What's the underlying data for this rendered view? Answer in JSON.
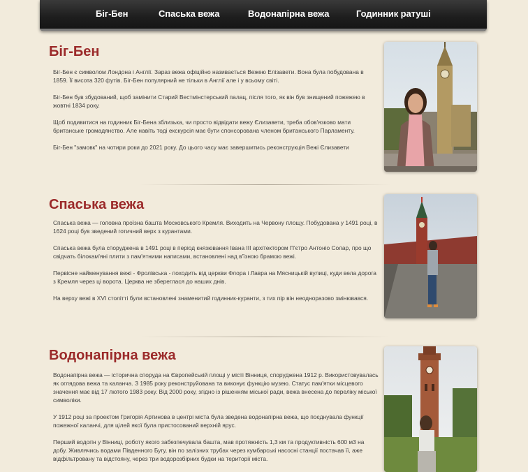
{
  "nav": {
    "items": [
      {
        "label": "Біг-Бен"
      },
      {
        "label": "Спаська вежа"
      },
      {
        "label": "Водонапірна вежа"
      },
      {
        "label": "Годинник ратуші"
      }
    ]
  },
  "sections": [
    {
      "title": "Біг-Бен",
      "paragraphs": [
        "Біг-Бен є символом Лондона і Англії. Зараз вежа офіційно називається Вежею Елізавети. Вона була побудована в 1859. Її висота 320 футів. Біг-Бен популярний не тільки в Англії але і у всьому світі.",
        "Біг-Бен був збудований, щоб замінити Старий Вестмінстерський палац, після того, як він був знищений пожежею в жовтні 1834 року.",
        "Щоб подивитися на годинник Біг-Бена зблизька, чи просто відвідати вежу Єлизавети, треба обов'язково мати британське громадянство. Але навіть тоді екскурсія має бути спонсорована членом британського Парламенту.",
        "Біг-Бен \"замовк\" на чотири роки до 2021 року. До цього часу має завершитись реконструкція Вежі Єлизавети"
      ]
    },
    {
      "title": "Спаська вежа",
      "paragraphs": [
        "Спаська вежа — головна проїзна башта Московського Кремля. Виходить на Червону площу. Побудована у 1491 році, в 1624 році був зведений готичний верх з курантами.",
        "Спаська вежа була споруджена в 1491 році в період князювання Івана III архітектором П'єтро Антоніо Солар, про що свідчать білокам'яні плити з пам'ятними написами, встановлені над в'їзною брамою вежі.",
        "Первісне найменування вежі - Фролівська - походить від церкви Флора і Лавра на Мясницькій вулиці, куди вела дорога з Кремля через ці ворота. Церква не збереглася до наших днів.",
        "На верху вежі в XVI столітті були встановлені знаменитий годинник-куранти, з тих пір він неодноразово змінювався."
      ]
    },
    {
      "title": "Водонапірна вежа",
      "paragraphs": [
        "Водонапірна вежа — історична споруда на Європейській площі у місті Вінниця, споруджена 1912 р. Використовувалась як оглядова вежа та каланча. З 1985 року реконструйована та виконує функцію музею. Статус пам'ятки місцевого значення має від 17 лютого 1983 року. Від 2000 року, згідно із рішенням міської ради, вежа внесена до переліку міської символіки.",
        "У 1912 році за проектом Григорія Артинова в центрі міста була зведена водонапірна вежа, що поєднувала функції пожежної каланчі, для цілей якої була пристосований верхній ярус.",
        "Перший водогін у Вінниці, роботу якого забезпечувала башта, мав протяжність 1,3 км та продуктивність 600 м3 на добу. Живлячись водами Південного Бугу, він по залізних трубах через кумбарські насосні станції постачав її, аже відфільтровану та відстояну, через три водорозбірних будки на території міста."
      ]
    }
  ]
}
